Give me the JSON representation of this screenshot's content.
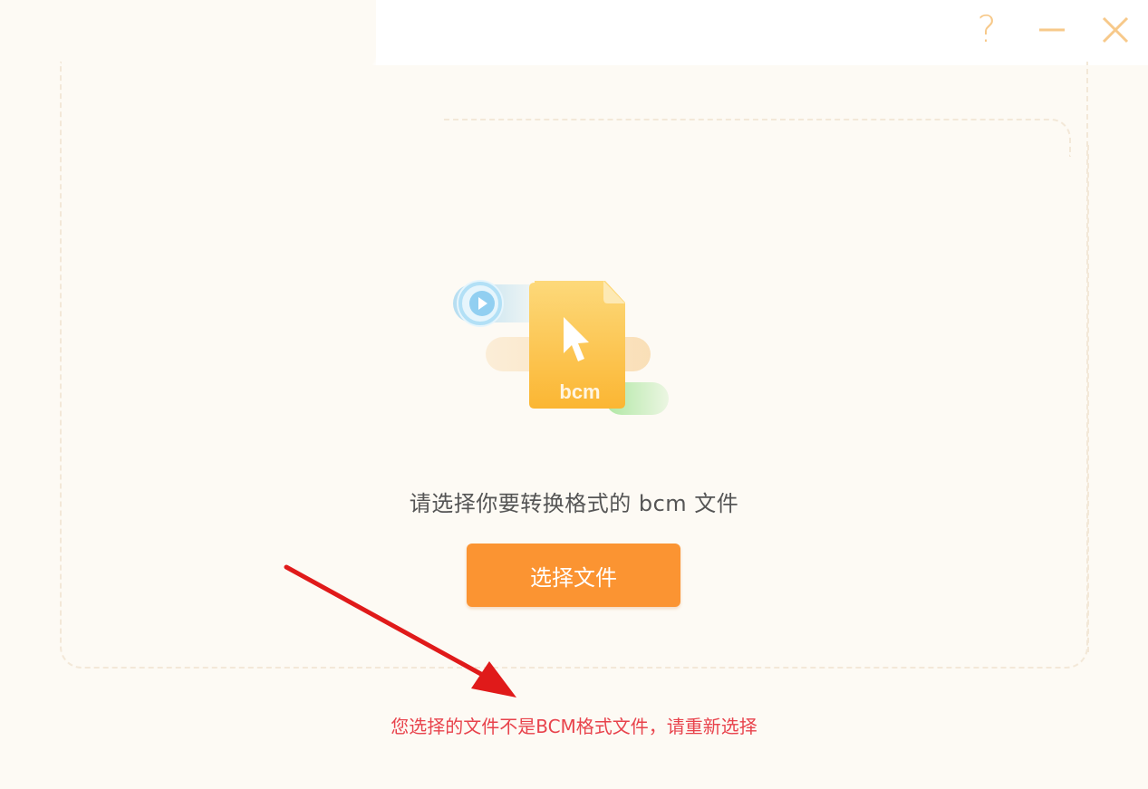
{
  "window": {
    "help_glyph": "?",
    "help_icon": "help-icon",
    "minimize_icon": "minimize-icon",
    "close_icon": "close-icon",
    "control_color": "#f7c98a"
  },
  "illustration": {
    "file_label": "bcm",
    "file_color": "#fbbc3a",
    "accent_blue": "#7cc6ee",
    "accent_green": "#a6e59a"
  },
  "main": {
    "prompt": "请选择你要转换格式的 bcm 文件",
    "select_button_label": "选择文件",
    "button_color": "#fb9432"
  },
  "status": {
    "error_message": "您选择的文件不是BCM格式文件，请重新选择",
    "error_color": "#e8434c"
  }
}
